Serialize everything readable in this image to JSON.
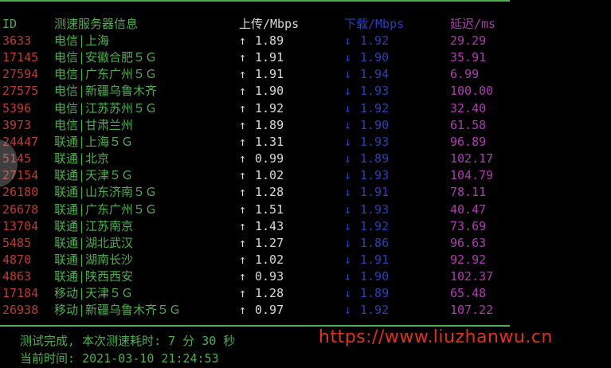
{
  "header": {
    "id": "ID",
    "server": "测速服务器信息",
    "upload": "上传/Mbps",
    "download": "下载/Mbps",
    "latency": "延迟/ms"
  },
  "arrows": {
    "up": "↑",
    "down": "↓"
  },
  "rows": [
    {
      "id": "3633",
      "server": "电信|上海",
      "up": "1.89",
      "down": "1.92",
      "latency": "29.29"
    },
    {
      "id": "17145",
      "server": "电信|安徽合肥５Ｇ",
      "up": "1.91",
      "down": "1.90",
      "latency": "35.91"
    },
    {
      "id": "27594",
      "server": "电信|广东广州５Ｇ",
      "up": "1.91",
      "down": "1.94",
      "latency": "6.99"
    },
    {
      "id": "27575",
      "server": "电信|新疆乌鲁木齐",
      "up": "1.90",
      "down": "1.93",
      "latency": "100.00"
    },
    {
      "id": "5396",
      "server": "电信|江苏苏州５Ｇ",
      "up": "1.92",
      "down": "1.92",
      "latency": "32.40"
    },
    {
      "id": "3973",
      "server": "电信|甘肃兰州",
      "up": "1.89",
      "down": "1.90",
      "latency": "61.58"
    },
    {
      "id": "24447",
      "server": "联通|上海５Ｇ",
      "up": "1.31",
      "down": "1.93",
      "latency": "96.89"
    },
    {
      "id": "5145",
      "server": "联通|北京",
      "up": "0.99",
      "down": "1.89",
      "latency": "102.17"
    },
    {
      "id": "27154",
      "server": "联通|天津５Ｇ",
      "up": "1.02",
      "down": "1.93",
      "latency": "104.79"
    },
    {
      "id": "26180",
      "server": "联通|山东济南５Ｇ",
      "up": "1.28",
      "down": "1.91",
      "latency": "78.11"
    },
    {
      "id": "26678",
      "server": "联通|广东广州５Ｇ",
      "up": "1.51",
      "down": "1.93",
      "latency": "40.47"
    },
    {
      "id": "13704",
      "server": "联通|江苏南京",
      "up": "1.43",
      "down": "1.92",
      "latency": "73.69"
    },
    {
      "id": "5485",
      "server": "联通|湖北武汉",
      "up": "1.27",
      "down": "1.86",
      "latency": "96.63"
    },
    {
      "id": "4870",
      "server": "联通|湖南长沙",
      "up": "1.02",
      "down": "1.91",
      "latency": "92.92"
    },
    {
      "id": "4863",
      "server": "联通|陕西西安",
      "up": "0.93",
      "down": "1.90",
      "latency": "102.37"
    },
    {
      "id": "17184",
      "server": "移动|天津５Ｇ",
      "up": "1.28",
      "down": "1.89",
      "latency": "65.48"
    },
    {
      "id": "26938",
      "server": "移动|新疆乌鲁木齐５Ｇ",
      "up": "0.97",
      "down": "1.92",
      "latency": "107.22"
    }
  ],
  "footer": {
    "done": "测试完成, 本次测速耗时: 7 分 30 秒",
    "time": "当前时间: 2021-03-10 21:24:53"
  },
  "watermark": "https://www.liuzhanwu.cn",
  "colors": {
    "background": "#000000",
    "id": "#c0392b",
    "server": "#4caf50",
    "upload": "#d9d9d9",
    "download": "#2b3fb8",
    "latency": "#b03ab3",
    "watermark": "#e0301e"
  }
}
